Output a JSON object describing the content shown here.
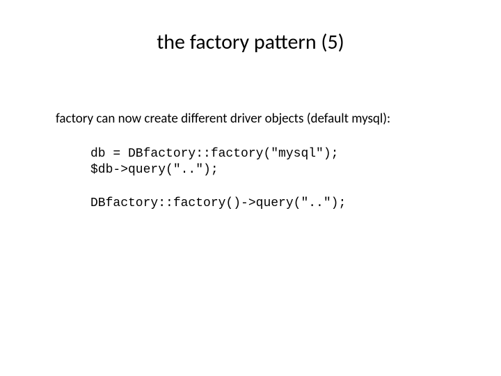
{
  "title": "the factory pattern (5)",
  "body": "factory can now create different driver objects (default mysql):",
  "code1_line1": "db = DBfactory::factory(\"mysql\");",
  "code1_line2": "$db->query(\"..\");",
  "code2_line1": "DBfactory::factory()->query(\"..\");"
}
